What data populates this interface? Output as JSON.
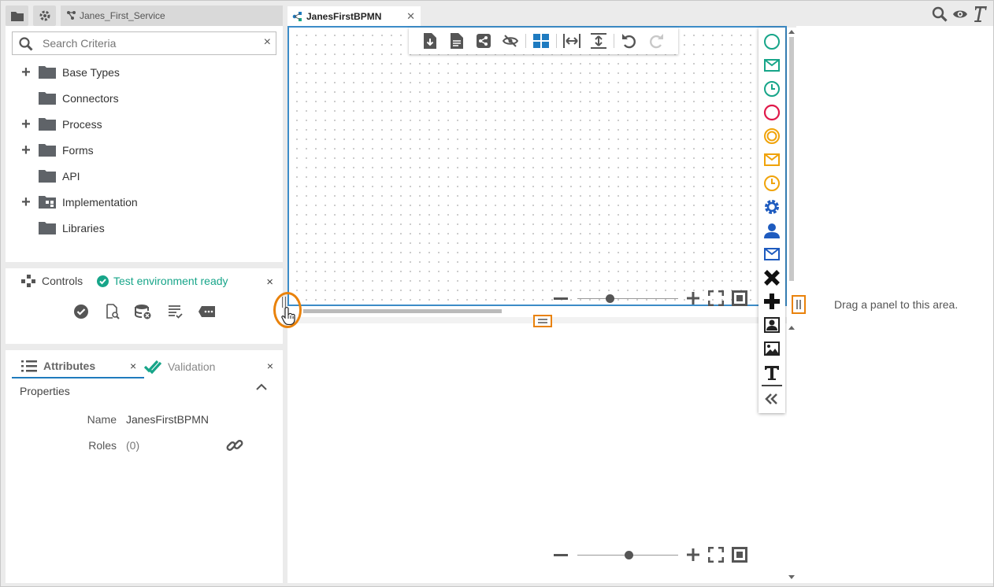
{
  "header": {
    "service_tab": "Janes_First_Service",
    "editor_tab": "JanesFirstBPMN"
  },
  "search": {
    "placeholder": "Search Criteria",
    "clear": "×"
  },
  "tree": [
    {
      "label": "Base Types",
      "expandable": true
    },
    {
      "label": "Connectors",
      "expandable": false
    },
    {
      "label": "Process",
      "expandable": true
    },
    {
      "label": "Forms",
      "expandable": true
    },
    {
      "label": "API",
      "expandable": false
    },
    {
      "label": "Implementation",
      "expandable": true
    },
    {
      "label": "Libraries",
      "expandable": false
    }
  ],
  "controls": {
    "title": "Controls",
    "status": "Test environment ready",
    "close": "×"
  },
  "attributes": {
    "tab_label": "Attributes",
    "validation_label": "Validation",
    "close": "×",
    "properties_title": "Properties",
    "name_label": "Name",
    "name_value": "JanesFirstBPMN",
    "roles_label": "Roles",
    "roles_value": "(0)"
  },
  "dock": {
    "text": "Drag a panel to this area."
  },
  "colors": {
    "accent_blue": "#3c8cc8",
    "status_green": "#17a589",
    "highlight_orange": "#e9820b",
    "palette_green": "#17a589",
    "palette_red": "#e0194a",
    "palette_yellow": "#f0a30a",
    "palette_blue": "#1e5bbf"
  },
  "palette_icons": [
    "start-event-icon",
    "message-start-event-icon",
    "timer-start-event-icon",
    "end-event-icon",
    "intermediate-event-icon",
    "message-intermediate-event-icon",
    "timer-intermediate-event-icon",
    "service-task-icon",
    "user-task-icon",
    "message-task-icon",
    "exclusive-gateway-icon",
    "parallel-gateway-icon",
    "user-component-icon",
    "image-icon",
    "text-annotation-icon",
    "collapse-palette-icon"
  ]
}
